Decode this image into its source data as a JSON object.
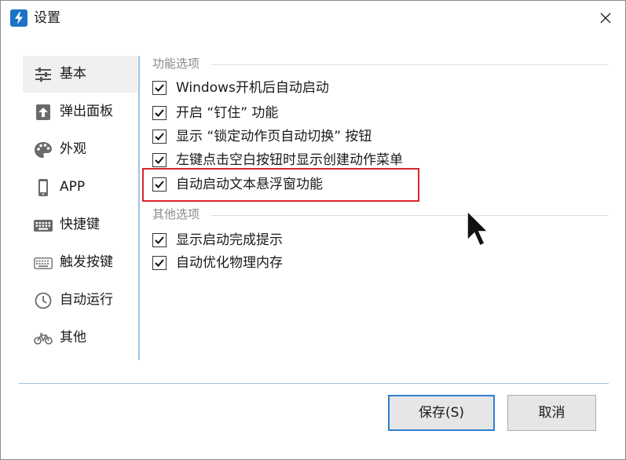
{
  "window": {
    "title": "设置",
    "app_icon": "lightning-icon",
    "close_icon": "close-icon"
  },
  "sidebar": {
    "items": [
      {
        "label": "基本",
        "icon": "sliders-icon",
        "active": true
      },
      {
        "label": "弹出面板",
        "icon": "arrow-up-icon",
        "active": false
      },
      {
        "label": "外观",
        "icon": "palette-icon",
        "active": false
      },
      {
        "label": "APP",
        "icon": "phone-icon",
        "active": false
      },
      {
        "label": "快捷键",
        "icon": "keyboard-icon",
        "active": false
      },
      {
        "label": "触发按键",
        "icon": "keyboard-outline-icon",
        "active": false
      },
      {
        "label": "自动运行",
        "icon": "clock-icon",
        "active": false
      },
      {
        "label": "其他",
        "icon": "bicycle-icon",
        "active": false
      }
    ]
  },
  "sections": {
    "features": {
      "title": "功能选项",
      "options": [
        {
          "label": "Windows开机后自动启动",
          "checked": true
        },
        {
          "label": "开启 “钉住” 功能",
          "checked": true
        },
        {
          "label": "显示 “锁定动作页自动切换” 按钮",
          "checked": true
        },
        {
          "label": "左键点击空白按钮时显示创建动作菜单",
          "checked": true
        },
        {
          "label": "自动启动文本悬浮窗功能",
          "checked": true
        }
      ]
    },
    "other": {
      "title": "其他选项",
      "options": [
        {
          "label": "显示启动完成提示",
          "checked": true
        },
        {
          "label": "自动优化物理内存",
          "checked": true
        }
      ]
    }
  },
  "buttons": {
    "save": "保存(S)",
    "cancel": "取消"
  },
  "colors": {
    "accent": "#2f7fcf",
    "divider": "#9ec3e6",
    "highlight": "#d8242b"
  }
}
